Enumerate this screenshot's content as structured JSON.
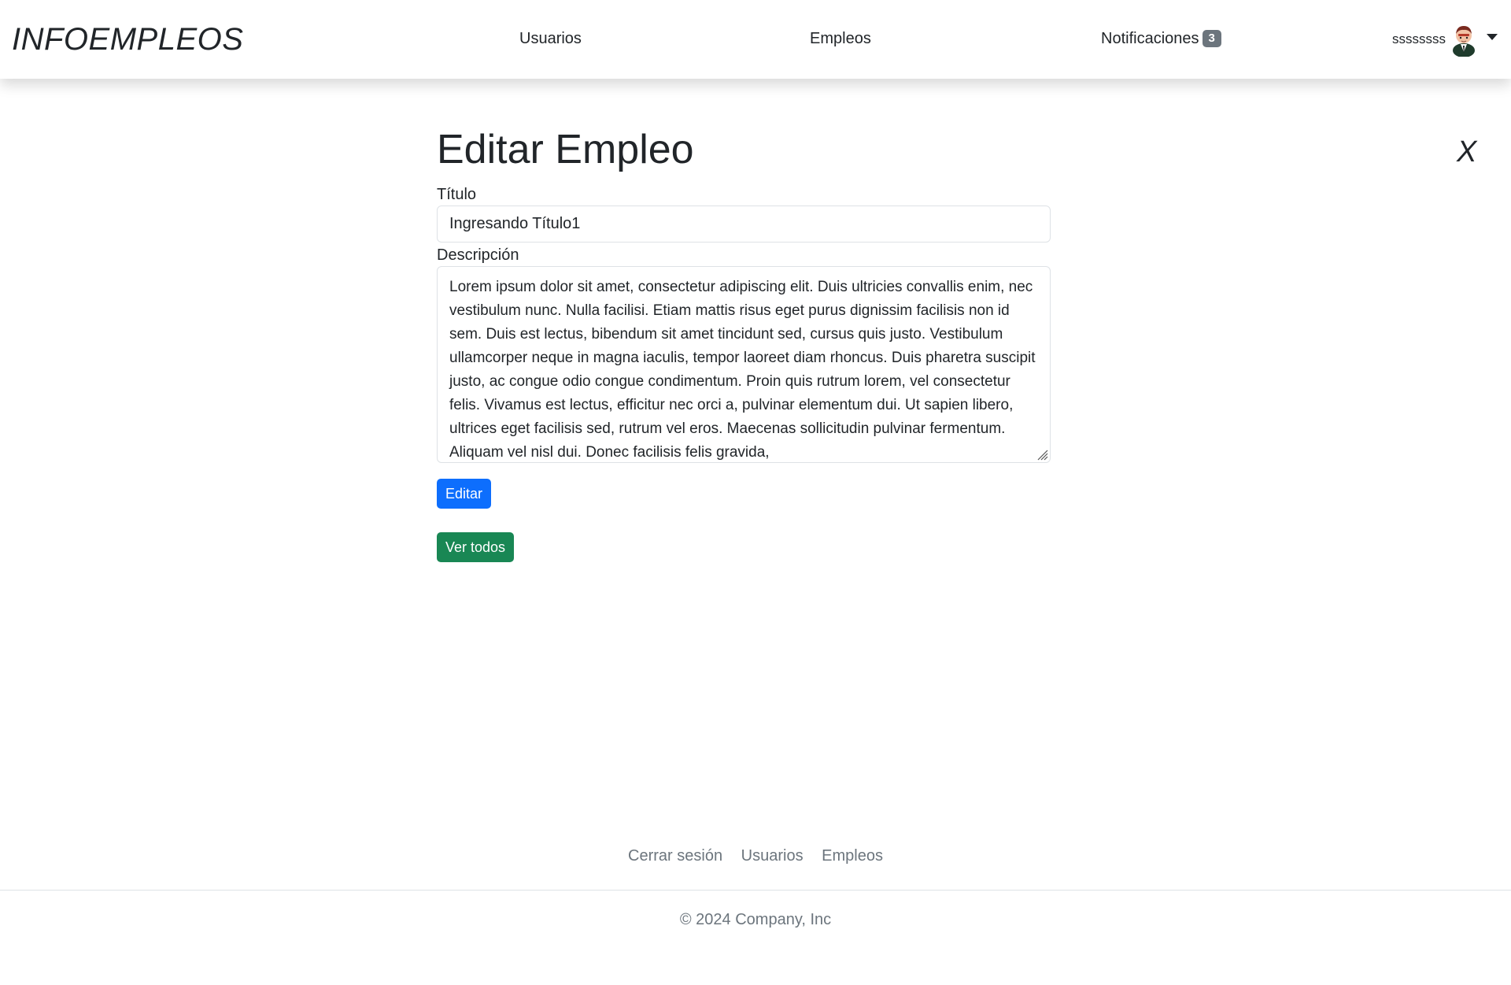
{
  "navbar": {
    "brand": "INFOEMPLEOS",
    "links": {
      "users": "Usuarios",
      "jobs": "Empleos",
      "notifications": "Notificaciones"
    },
    "notification_count": "3",
    "user_name": "ssssssss",
    "avatar_icon": "user-avatar-icon"
  },
  "main": {
    "title": "Editar Empleo",
    "close_label": "X",
    "form": {
      "title_label": "Título",
      "title_value": "Ingresando Título1",
      "description_label": "Descripción",
      "description_value": "Lorem ipsum dolor sit amet, consectetur adipiscing elit. Duis ultricies convallis enim, nec vestibulum nunc. Nulla facilisi. Etiam mattis risus eget purus dignissim facilisis non id sem. Duis est lectus, bibendum sit amet tincidunt sed, cursus quis justo. Vestibulum ullamcorper neque in magna iaculis, tempor laoreet diam rhoncus. Duis pharetra suscipit justo, ac congue odio congue condimentum. Proin quis rutrum lorem, vel consectetur felis. Vivamus est lectus, efficitur nec orci a, pulvinar elementum dui. Ut sapien libero, ultrices eget facilisis sed, rutrum vel eros. Maecenas sollicitudin pulvinar fermentum. Aliquam vel nisl dui. Donec facilisis felis gravida,",
      "submit_label": "Editar"
    },
    "view_all_label": "Ver todos"
  },
  "footer": {
    "links": {
      "logout": "Cerrar sesión",
      "users": "Usuarios",
      "jobs": "Empleos"
    },
    "copyright": "© 2024 Company, Inc"
  },
  "colors": {
    "primary": "#0d6efd",
    "success": "#198754",
    "badge": "#6c757d",
    "text": "#212529",
    "muted": "#6c757d"
  }
}
